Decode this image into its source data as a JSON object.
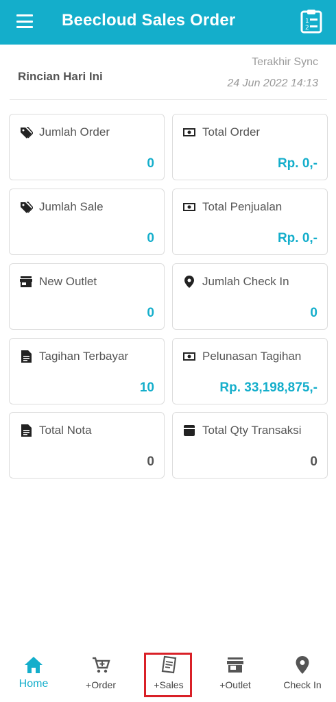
{
  "appbar": {
    "title": "Beecloud Sales Order",
    "menu_icon": "hamburger-menu-icon",
    "action_icon": "clipboard-list-icon",
    "color": "#14aecb"
  },
  "summary": {
    "title": "Rincian Hari Ini",
    "sync_label": "Terakhir Sync",
    "sync_time": "24 Jun 2022 14:13"
  },
  "cards": [
    {
      "label": "Jumlah Order",
      "value": "0",
      "icon": "tag-icon"
    },
    {
      "label": "Total Order",
      "value": "Rp. 0,-",
      "icon": "money-icon"
    },
    {
      "label": "Jumlah Sale",
      "value": "0",
      "icon": "tag-icon"
    },
    {
      "label": "Total Penjualan",
      "value": "Rp. 0,-",
      "icon": "money-icon"
    },
    {
      "label": "New Outlet",
      "value": "0",
      "icon": "store-icon"
    },
    {
      "label": "Jumlah Check In",
      "value": "0",
      "icon": "location-pin-icon"
    },
    {
      "label": "Tagihan Terbayar",
      "value": "10",
      "icon": "document-icon"
    },
    {
      "label": "Pelunasan Tagihan",
      "value": "Rp. 33,198,875,-",
      "icon": "money-icon"
    },
    {
      "label": "Total Nota",
      "value": "0",
      "icon": "document-icon"
    },
    {
      "label": "Total Qty Transaksi",
      "value": "0",
      "icon": "card-icon"
    }
  ],
  "bottom_nav": [
    {
      "label": "Home",
      "icon": "home-icon",
      "active": true
    },
    {
      "label": "+Order",
      "icon": "cart-plus-icon",
      "active": false
    },
    {
      "label": "+Sales",
      "icon": "receipt-icon",
      "active": false
    },
    {
      "label": "+Outlet",
      "icon": "store-icon",
      "active": false
    },
    {
      "label": "Check In",
      "icon": "location-pin-icon",
      "active": false
    }
  ]
}
